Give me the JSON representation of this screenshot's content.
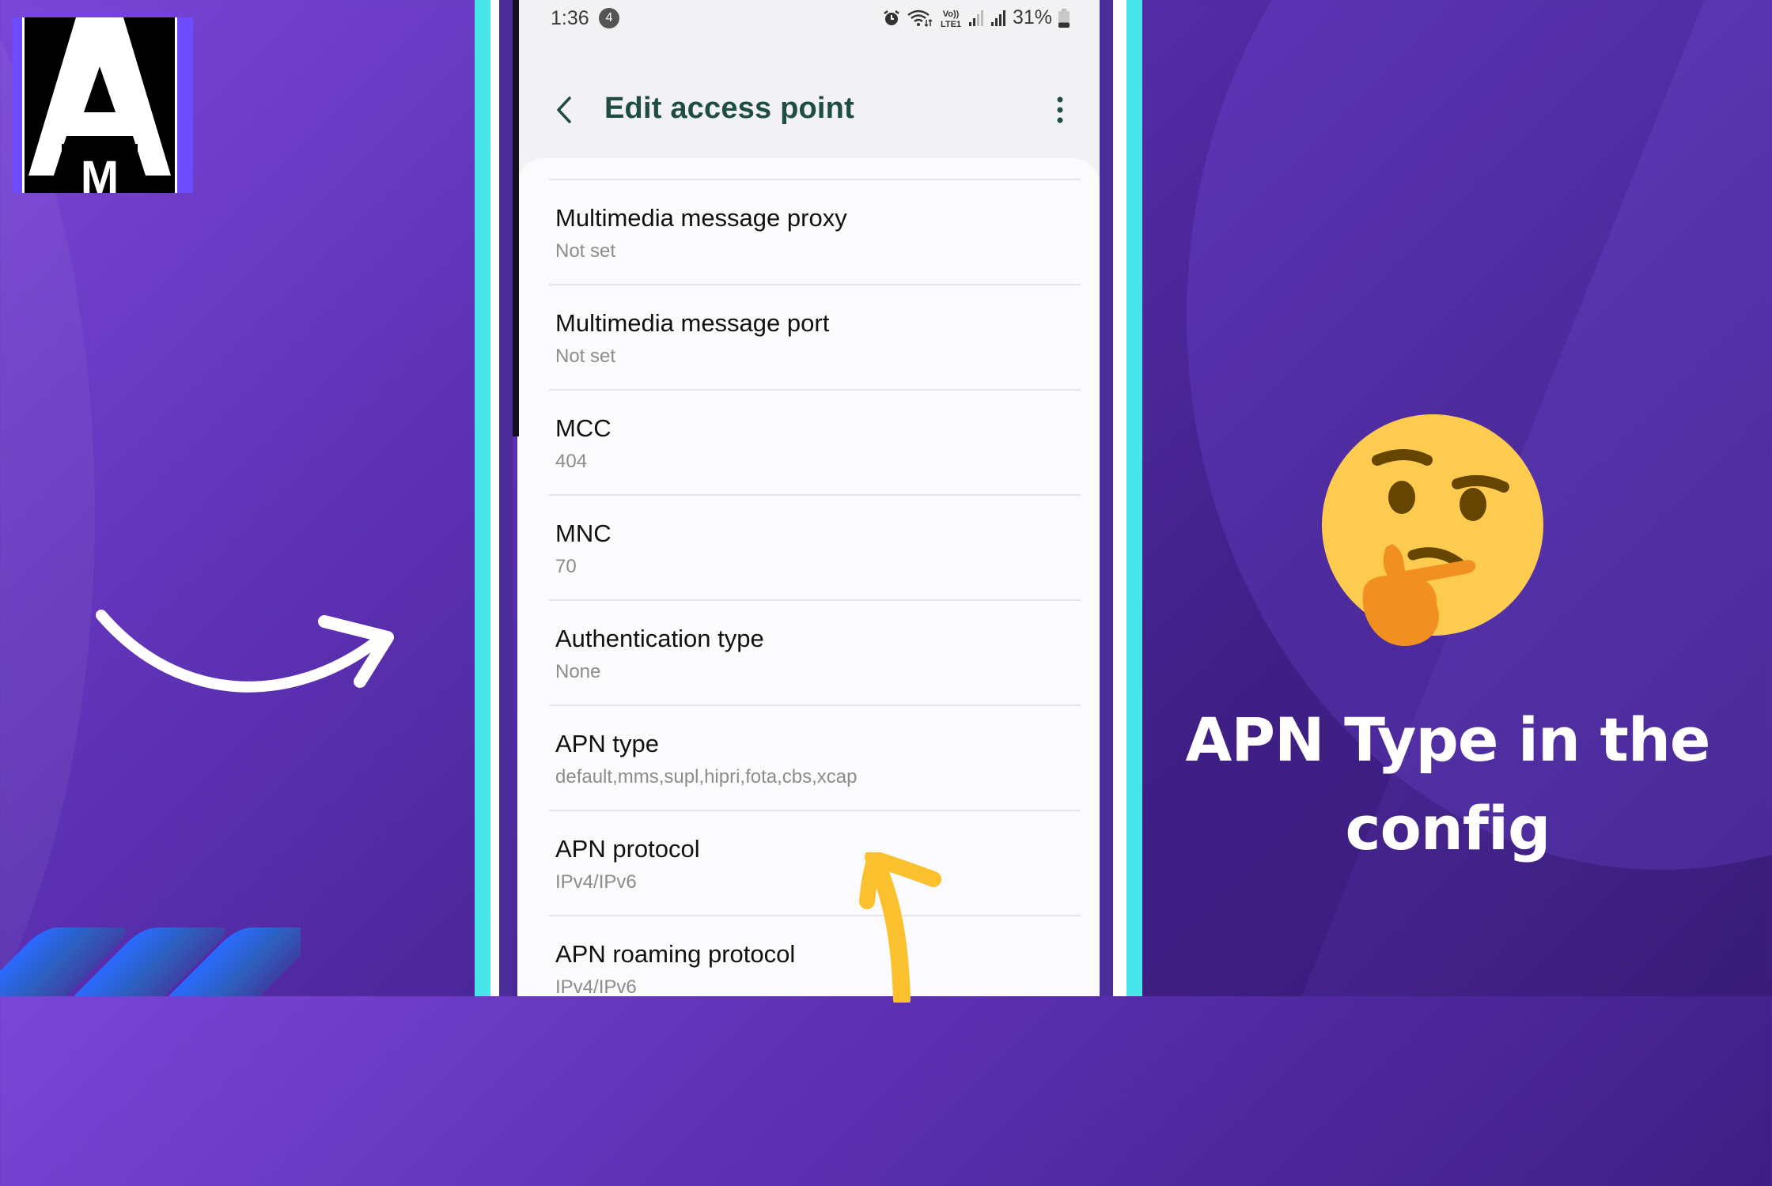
{
  "brand": {
    "logo_letter_main": "A",
    "logo_letter_sub": "M"
  },
  "colors": {
    "background_purple": "#5a2fb0",
    "frame_cyan": "#48e6ea",
    "title_green": "#1f4c43",
    "annotation_yellow": "#fbc02d",
    "emoji_face": "#fdcb4f",
    "emoji_hand": "#f19020"
  },
  "status_bar": {
    "time": "1:36",
    "notification_count": "4",
    "icons": [
      "alarm-icon",
      "wifi-icon",
      "volte-icon",
      "signal-sim1-icon",
      "signal-sim2-icon",
      "battery-icon"
    ],
    "volte_label_top": "Vo))",
    "volte_label_bottom": "LTE1",
    "battery_percent": "31%",
    "battery_level": 0.31
  },
  "app_bar": {
    "title": "Edit access point",
    "back_icon": "chevron-left-icon",
    "menu_icon": "more-vertical-icon"
  },
  "settings": [
    {
      "title": "Multimedia message proxy",
      "value": "Not set"
    },
    {
      "title": "Multimedia message port",
      "value": "Not set"
    },
    {
      "title": "MCC",
      "value": "404"
    },
    {
      "title": "MNC",
      "value": "70"
    },
    {
      "title": "Authentication type",
      "value": "None"
    },
    {
      "title": "APN type",
      "value": "default,mms,supl,hipri,fota,cbs,xcap"
    },
    {
      "title": "APN protocol",
      "value": "IPv4/IPv6"
    },
    {
      "title": "APN roaming protocol",
      "value": "IPv4/IPv6"
    }
  ],
  "overlay": {
    "headline_line1": "APN Type in the",
    "headline_line2": "config",
    "emoji": "thinking-face-emoji"
  }
}
